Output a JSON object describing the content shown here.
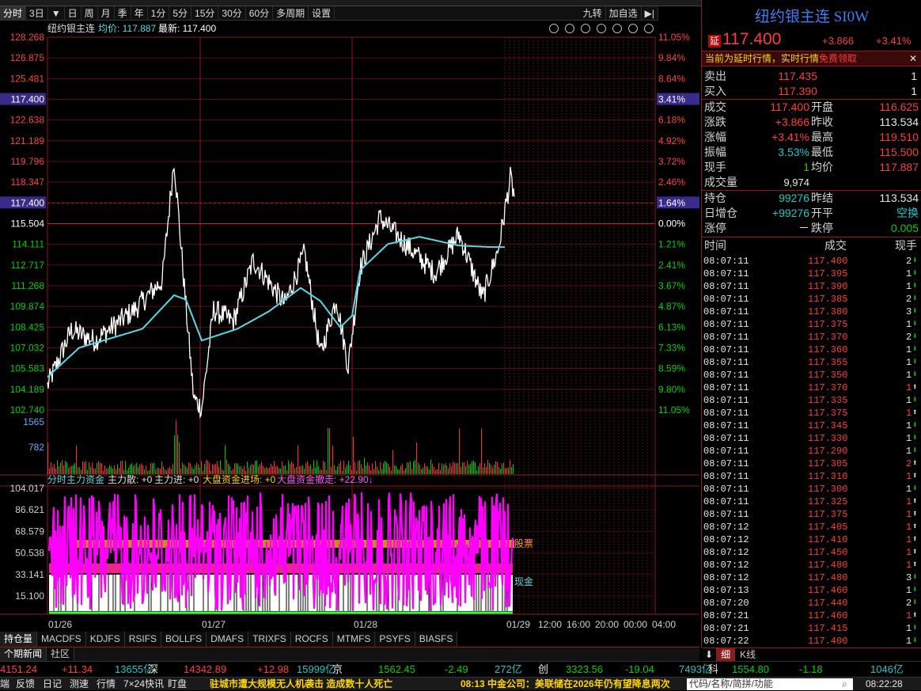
{
  "toolbar": {
    "items": [
      "分时",
      "3日",
      "▼",
      "日",
      "周",
      "月",
      "季",
      "年",
      "1分",
      "5分",
      "15分",
      "30分",
      "60分",
      "多周期",
      "设置"
    ],
    "right": [
      "九转",
      "加自选",
      "▶|"
    ]
  },
  "chart_header": {
    "name": "纽约银主连",
    "avg_label": "均价: 117.887",
    "last_label": "最新: 117.400"
  },
  "price_axis": {
    "left": [
      "128.268",
      "126.875",
      "125.481",
      "117.400",
      "122.638",
      "121.189",
      "119.796",
      "118.347",
      "117.400",
      "115.504",
      "114.111",
      "112.717",
      "111.268",
      "109.874",
      "108.425",
      "107.032",
      "105.583",
      "104.189",
      "102.740"
    ],
    "right": [
      "11.05%",
      "9.84%",
      "8.64%",
      "3.41%",
      "6.18%",
      "4.92%",
      "3.72%",
      "2.46%",
      "1.64%",
      "0.00%",
      "1.21%",
      "2.41%",
      "3.67%",
      "4.87%",
      "6.13%",
      "7.33%",
      "8.59%",
      "9.80%",
      "11.05%"
    ]
  },
  "volume_axis": [
    "1565",
    "782"
  ],
  "fund_header": {
    "title": "分时主力资金",
    "items": [
      "主力散: +0",
      "主力进: +0",
      "大盘资金进场: +0",
      "大盘资金撤走: +22.90↓"
    ]
  },
  "fund_axis": [
    "104.017",
    "86.621",
    "68.579",
    "50.538",
    "33.141",
    "15.100"
  ],
  "fund_labels": {
    "stocks": "股票",
    "cash": "现金"
  },
  "date_labels": [
    "01/26",
    "01/27",
    "01/28",
    "01/29"
  ],
  "time_labels": [
    "12:00",
    "16:00",
    "20:00",
    "00:00",
    "04:00"
  ],
  "indicator_tabs": [
    "持仓量",
    "MACDFS",
    "KDJFS",
    "RSIFS",
    "BOLLFS",
    "DMAFS",
    "TRIXFS",
    "ROCFS",
    "MTMFS",
    "PSYFS",
    "BIASFS"
  ],
  "news_tabs": [
    "个期新闻",
    "社区"
  ],
  "quote": {
    "title": "纽约银主连 SI0W",
    "delay_tag": "延",
    "price": "117.400",
    "change": "+3.866",
    "pct": "+3.41%",
    "notice": "当前为延时行情，实时行情",
    "notice_link": "免费领取",
    "ask_label": "卖出",
    "ask": "117.435",
    "ask_vol": "1",
    "bid_label": "买入",
    "bid": "117.390",
    "bid_vol": "1",
    "fields": [
      {
        "l1": "成交",
        "v1": "117.400",
        "l2": "开盘",
        "v2": "116.625"
      },
      {
        "l1": "涨跌",
        "v1": "+3.866",
        "l2": "昨收",
        "v2": "113.534"
      },
      {
        "l1": "涨幅",
        "v1": "+3.41%",
        "l2": "最高",
        "v2": "119.510"
      },
      {
        "l1": "振幅",
        "v1": "3.53%",
        "l2": "最低",
        "v2": "115.500"
      },
      {
        "l1": "现手",
        "v1": "1",
        "l2": "均价",
        "v2": "117.887"
      }
    ],
    "volume_label": "成交量",
    "volume": "9,974",
    "oi_fields": [
      {
        "l1": "持仓",
        "v1": "99276",
        "l2": "昨结",
        "v2": "113.534"
      },
      {
        "l1": "日增仓",
        "v1": "+99276",
        "l2": "开平",
        "v2": "空换"
      },
      {
        "l1": "涨停",
        "v1": "－",
        "l2": "跌停",
        "v2": "0.005"
      }
    ]
  },
  "ticks_header": {
    "time": "时间",
    "price": "成交",
    "qty": "现手"
  },
  "ticks": [
    {
      "t": "08:07:11",
      "p": "117.400",
      "q": "2",
      "d": "down"
    },
    {
      "t": "08:07:11",
      "p": "117.395",
      "q": "1",
      "d": "down"
    },
    {
      "t": "08:07:11",
      "p": "117.390",
      "q": "1",
      "d": "down"
    },
    {
      "t": "08:07:11",
      "p": "117.385",
      "q": "2",
      "d": "down"
    },
    {
      "t": "08:07:11",
      "p": "117.380",
      "q": "3",
      "d": "down"
    },
    {
      "t": "08:07:11",
      "p": "117.375",
      "q": "1",
      "d": "down"
    },
    {
      "t": "08:07:11",
      "p": "117.370",
      "q": "2",
      "d": "down"
    },
    {
      "t": "08:07:11",
      "p": "117.360",
      "q": "1",
      "d": "down"
    },
    {
      "t": "08:07:11",
      "p": "117.355",
      "q": "1",
      "d": "down"
    },
    {
      "t": "08:07:11",
      "p": "117.350",
      "q": "1",
      "d": "down"
    },
    {
      "t": "08:07:11",
      "p": "117.370",
      "q": "1",
      "d": "up"
    },
    {
      "t": "08:07:11",
      "p": "117.335",
      "q": "1",
      "d": "down"
    },
    {
      "t": "08:07:11",
      "p": "117.375",
      "q": "1",
      "d": "up"
    },
    {
      "t": "08:07:11",
      "p": "117.345",
      "q": "1",
      "d": "down"
    },
    {
      "t": "08:07:11",
      "p": "117.330",
      "q": "1",
      "d": "down"
    },
    {
      "t": "08:07:11",
      "p": "117.290",
      "q": "1",
      "d": "down"
    },
    {
      "t": "08:07:11",
      "p": "117.305",
      "q": "2",
      "d": "up"
    },
    {
      "t": "08:07:11",
      "p": "117.310",
      "q": "1",
      "d": "up"
    },
    {
      "t": "08:07:11",
      "p": "117.300",
      "q": "1",
      "d": "down"
    },
    {
      "t": "08:07:11",
      "p": "117.325",
      "q": "1",
      "d": "up"
    },
    {
      "t": "08:07:11",
      "p": "117.375",
      "q": "1",
      "d": "up"
    },
    {
      "t": "08:07:12",
      "p": "117.405",
      "q": "1",
      "d": "up"
    },
    {
      "t": "08:07:12",
      "p": "117.410",
      "q": "1",
      "d": "up"
    },
    {
      "t": "08:07:12",
      "p": "117.450",
      "q": "1",
      "d": "up"
    },
    {
      "t": "08:07:12",
      "p": "117.480",
      "q": "1",
      "d": "up"
    },
    {
      "t": "08:07:12",
      "p": "117.480",
      "q": "3",
      "d": "down"
    },
    {
      "t": "08:07:13",
      "p": "117.460",
      "q": "1",
      "d": "down"
    },
    {
      "t": "08:07:20",
      "p": "117.440",
      "q": "2",
      "d": "down"
    },
    {
      "t": "08:07:21",
      "p": "117.460",
      "q": "1",
      "d": "up"
    },
    {
      "t": "08:07:21",
      "p": "117.415",
      "q": "1",
      "d": "down"
    },
    {
      "t": "08:07:22",
      "p": "117.400",
      "q": "1",
      "d": "down"
    }
  ],
  "side_tabs": [
    "细",
    "K线"
  ],
  "market": [
    {
      "v": "4151.24",
      "c": "+11.34",
      "a": "13655亿"
    },
    {
      "n": "深",
      "v": "14342.89",
      "c": "+12.98",
      "a": "15999亿"
    },
    {
      "n": "京",
      "v": "1562.45",
      "c": "-2.49",
      "a": "272亿"
    },
    {
      "n": "创",
      "v": "3323.56",
      "c": "-19.04",
      "a": "7493亿"
    },
    {
      "n": "科",
      "v": "1554.80",
      "c": "-1.18",
      "a": "1046亿"
    }
  ],
  "status": {
    "left": [
      "端",
      "反馈",
      "日记",
      "测速",
      "行情",
      "7×24快讯",
      "盯盘"
    ],
    "news1": "驻城市遭大规模无人机袭击 造成数十人死亡",
    "news2": "08:13 中金公司：美联储在2026年仍有望降息两次",
    "search": "代码/名称/简拼/功能",
    "time": "08:22:28"
  },
  "colors": {
    "up": "#ff3b3b",
    "down": "#00d000",
    "avg": "#5ad8e6",
    "price": "#ffffff",
    "fund": "#ff00ff",
    "grid": "#8b1a1a"
  }
}
